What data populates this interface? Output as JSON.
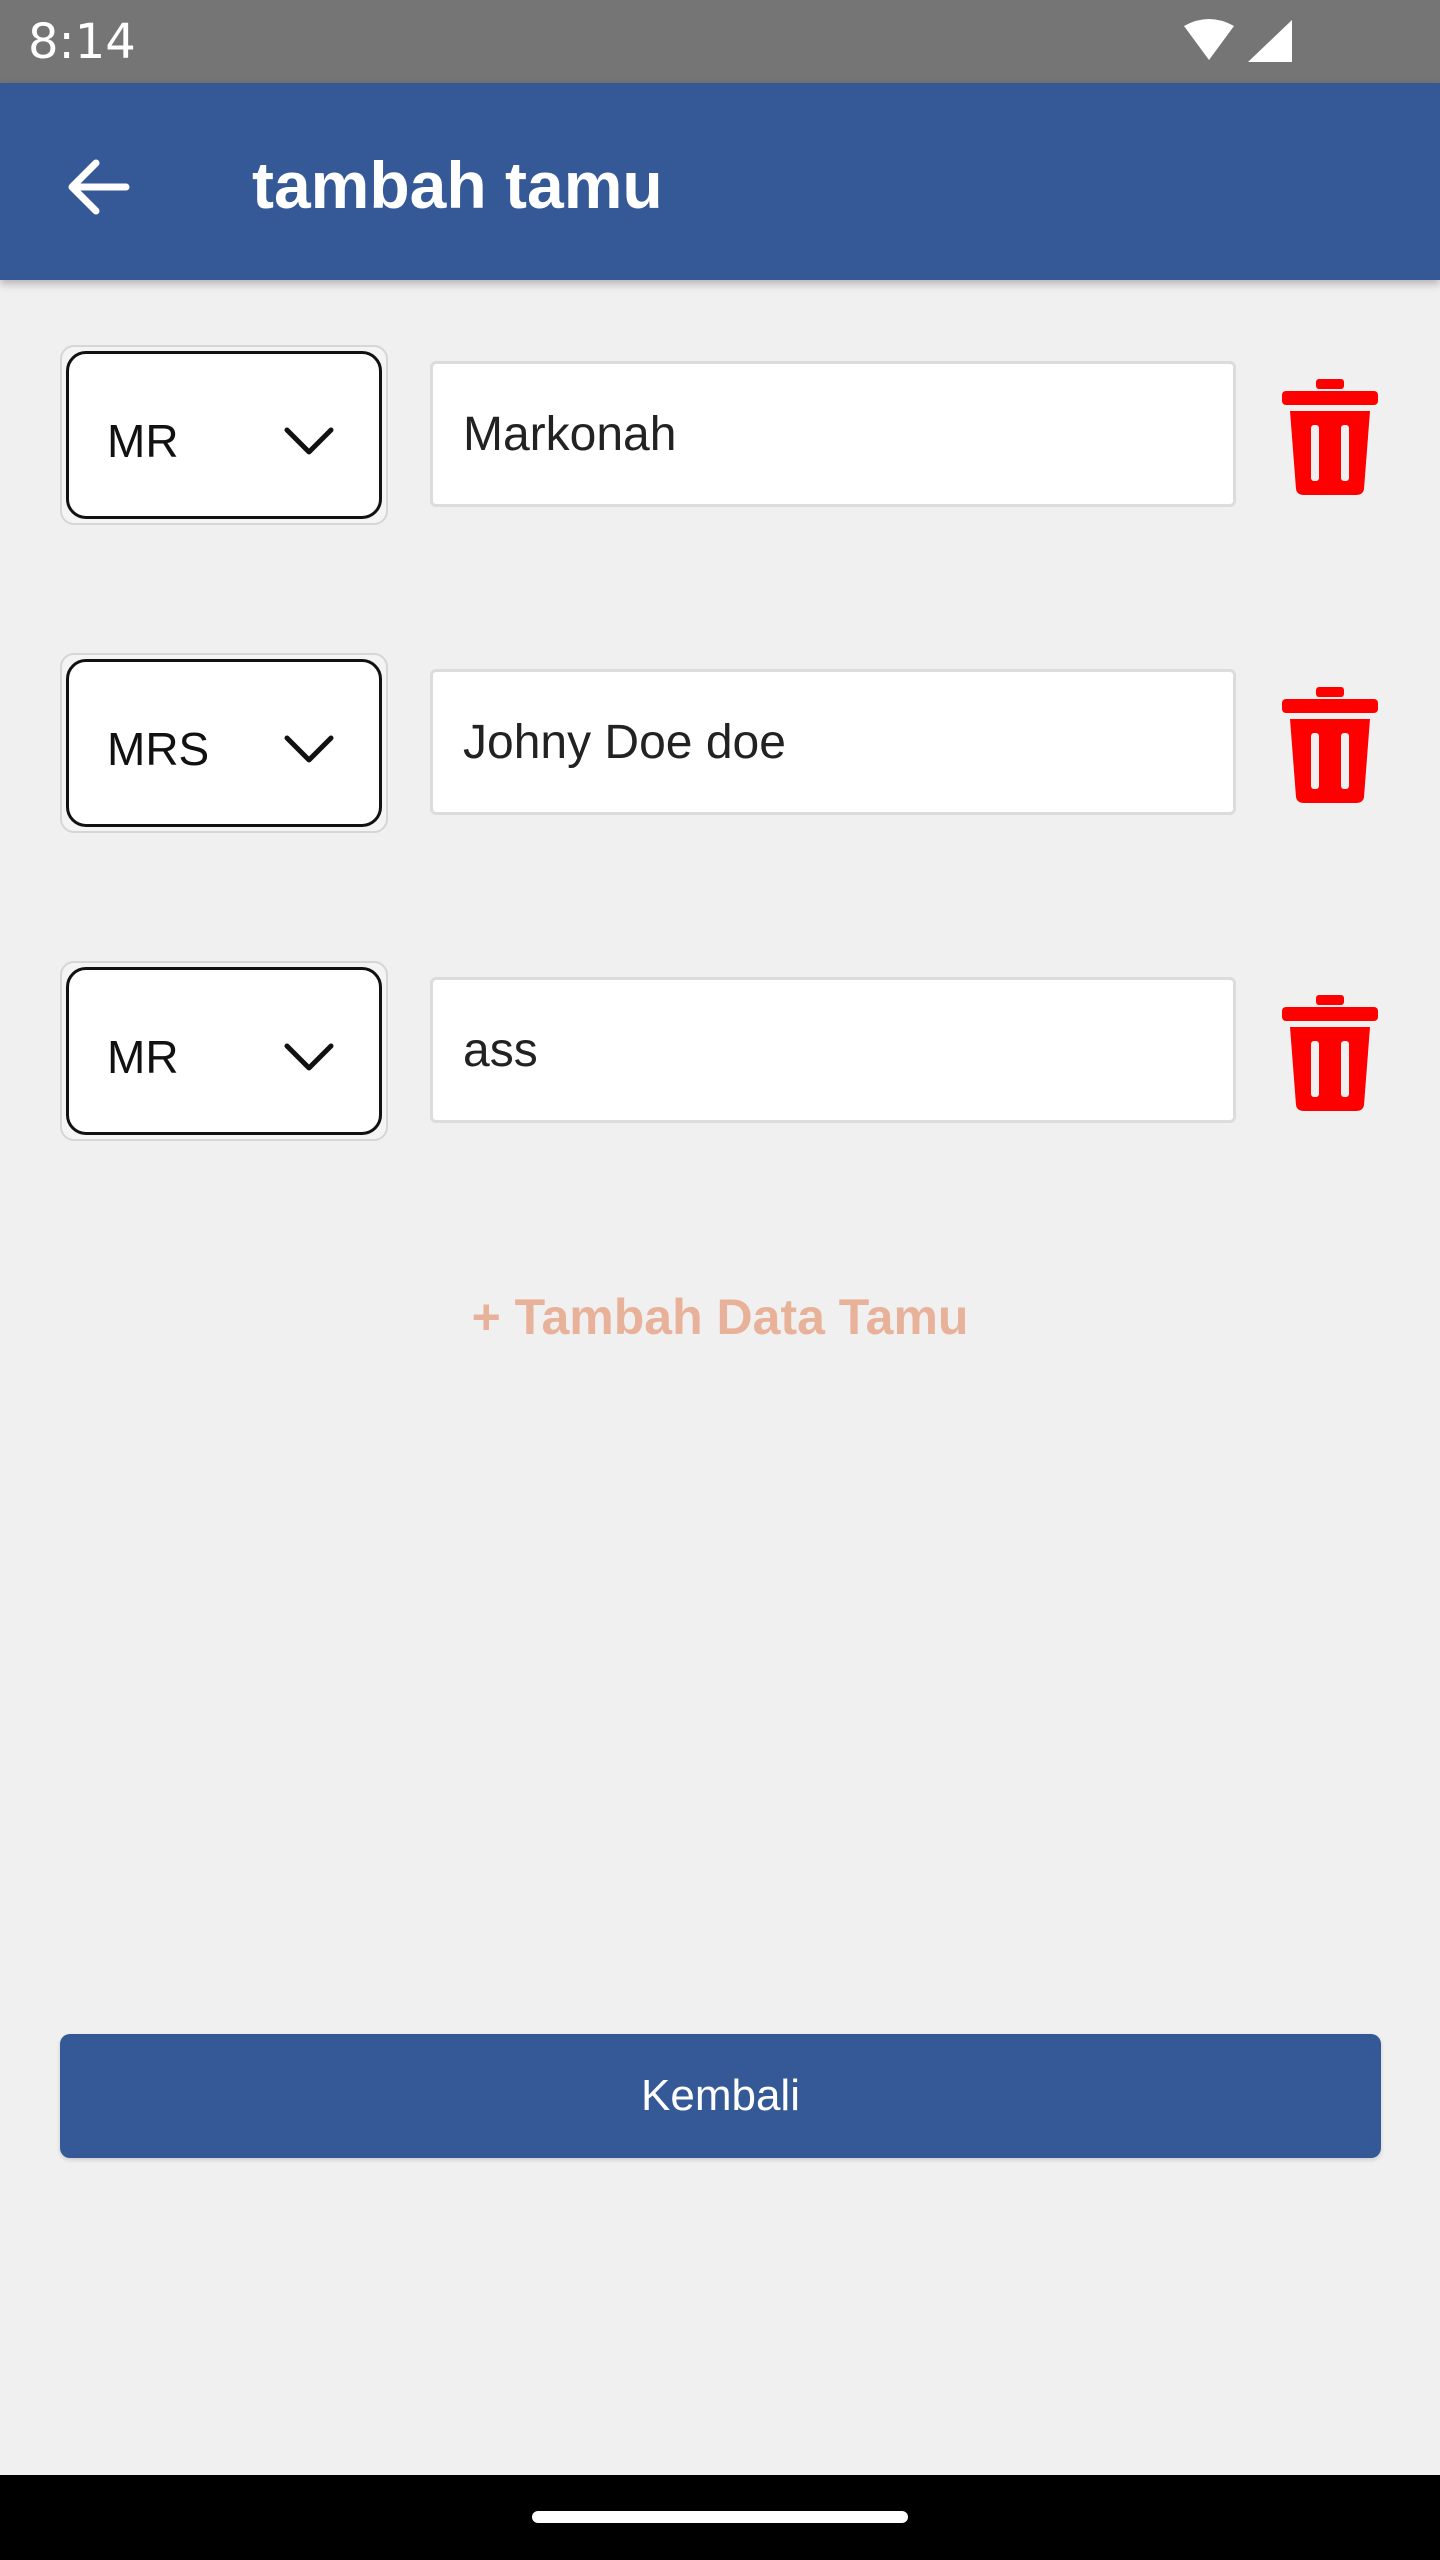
{
  "status_bar": {
    "time": "8:14",
    "icons": [
      "wifi-icon",
      "signal-icon"
    ]
  },
  "app_bar": {
    "title": "tambah tamu",
    "back_icon": "arrow-left-icon",
    "background_color": "#345996"
  },
  "guests": [
    {
      "title": "MR",
      "name": "Markonah"
    },
    {
      "title": "MRS",
      "name": "Johny Doe doe"
    },
    {
      "title": "MR",
      "name": "ass"
    }
  ],
  "delete_icon": "trash-icon",
  "delete_color": "#ff0000",
  "add_guest_label": "+ Tambah Data Tamu",
  "add_guest_color": "#e8b29a",
  "back_button_label": "Kembali"
}
